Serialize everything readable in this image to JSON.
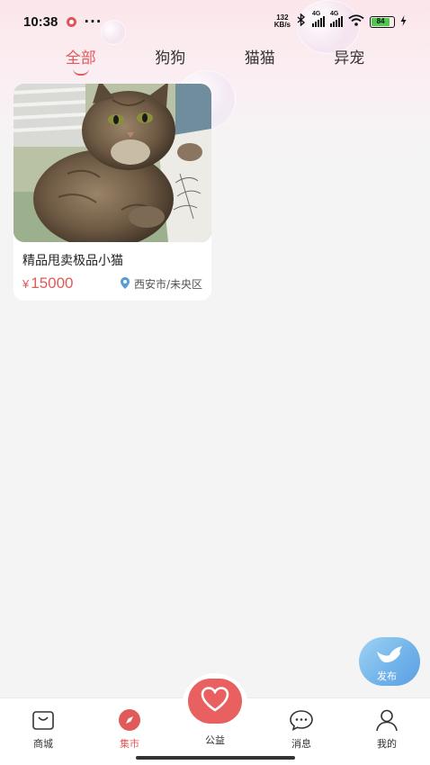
{
  "status_bar": {
    "time": "10:38",
    "more": "···",
    "net_speed_value": "132",
    "net_speed_unit": "KB/s",
    "network_1": "4G",
    "network_2": "4G",
    "battery": "84"
  },
  "tabs": [
    {
      "label": "全部",
      "active": true
    },
    {
      "label": "狗狗",
      "active": false
    },
    {
      "label": "猫猫",
      "active": false
    },
    {
      "label": "异宠",
      "active": false
    }
  ],
  "listings": [
    {
      "title": "精品甩卖极品小猫",
      "currency": "¥",
      "price": "15000",
      "location": "西安市/未央区",
      "image": "kitten-photo"
    }
  ],
  "fab": {
    "label": "发布",
    "icon": "bird-icon"
  },
  "bottom_nav": [
    {
      "label": "商城",
      "icon": "shop-bag-icon",
      "active": false
    },
    {
      "label": "集市",
      "icon": "compass-icon",
      "active": true
    },
    {
      "label": "公益",
      "icon": "heart-icon",
      "active": false
    },
    {
      "label": "消息",
      "icon": "chat-bubble-icon",
      "active": false
    },
    {
      "label": "我的",
      "icon": "person-icon",
      "active": false
    }
  ],
  "colors": {
    "accent": "#e05a5a",
    "fab": "#6fb2ea",
    "location_pin": "#5b9bd5",
    "background": "#f4f4f4"
  }
}
